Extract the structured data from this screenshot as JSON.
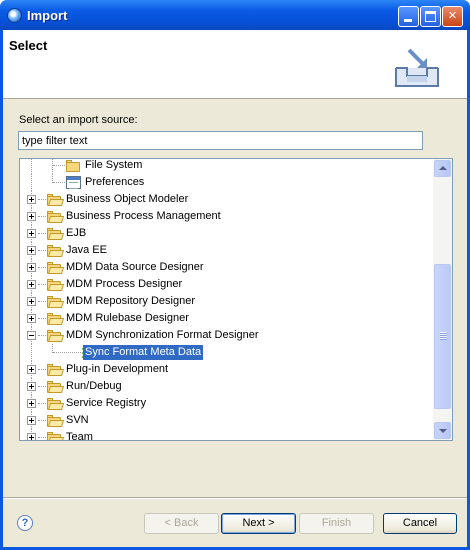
{
  "window": {
    "title": "Import",
    "minimize_icon": "minimize-icon",
    "maximize_icon": "maximize-icon",
    "close_icon": "close-icon",
    "close_glyph": "✕"
  },
  "header": {
    "title": "Select",
    "image_icon": "import-tray-icon"
  },
  "source": {
    "label": "Select an import source:",
    "filter_value": "type filter text"
  },
  "tree": {
    "items": [
      {
        "label": "File System",
        "icon": "folder-icon",
        "depth": 1
      },
      {
        "label": "Preferences",
        "icon": "preferences-icon",
        "depth": 1
      },
      {
        "label": "Business Object Modeler",
        "icon": "folder-icon",
        "expander": "plus"
      },
      {
        "label": "Business Process Management",
        "icon": "folder-icon",
        "expander": "plus"
      },
      {
        "label": "EJB",
        "icon": "folder-icon",
        "expander": "plus"
      },
      {
        "label": "Java EE",
        "icon": "folder-icon",
        "expander": "plus"
      },
      {
        "label": "MDM Data Source Designer",
        "icon": "folder-icon",
        "expander": "plus"
      },
      {
        "label": "MDM Process Designer",
        "icon": "folder-icon",
        "expander": "plus"
      },
      {
        "label": "MDM Repository Designer",
        "icon": "folder-icon",
        "expander": "plus"
      },
      {
        "label": "MDM Rulebase Designer",
        "icon": "folder-icon",
        "expander": "plus"
      },
      {
        "label": "MDM Synchronization Format Designer",
        "icon": "folder-open-icon",
        "expander": "minus"
      },
      {
        "label": "Sync Format Meta Data",
        "icon": "grid-icon",
        "depth": 1,
        "selected": true
      },
      {
        "label": "Plug-in Development",
        "icon": "folder-icon",
        "expander": "plus"
      },
      {
        "label": "Run/Debug",
        "icon": "folder-icon",
        "expander": "plus"
      },
      {
        "label": "Service Registry",
        "icon": "folder-icon",
        "expander": "plus"
      },
      {
        "label": "SVN",
        "icon": "folder-icon",
        "expander": "plus"
      },
      {
        "label": "Team",
        "icon": "folder-icon",
        "expander": "plus"
      }
    ]
  },
  "footer": {
    "help_glyph": "?",
    "back_label": "< Back",
    "next_label": "Next >",
    "finish_label": "Finish",
    "cancel_label": "Cancel"
  }
}
